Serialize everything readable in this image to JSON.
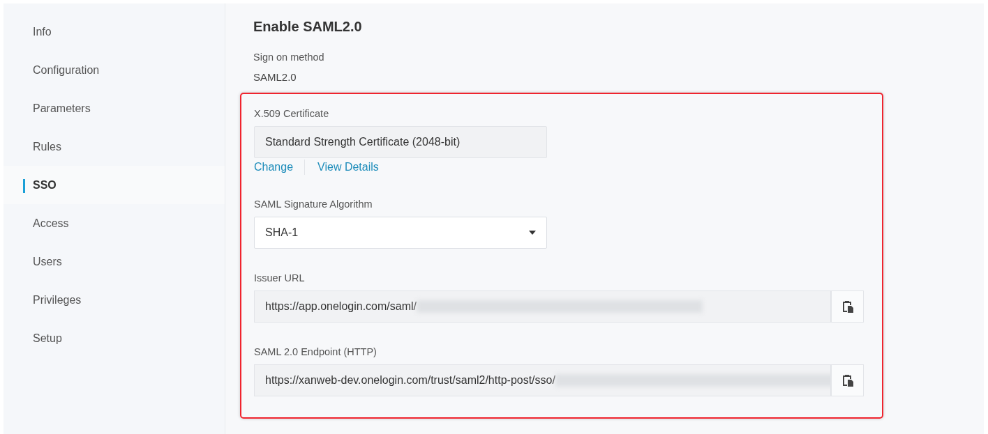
{
  "sidebar": {
    "items": [
      {
        "label": "Info",
        "selected": false
      },
      {
        "label": "Configuration",
        "selected": false
      },
      {
        "label": "Parameters",
        "selected": false
      },
      {
        "label": "Rules",
        "selected": false
      },
      {
        "label": "SSO",
        "selected": true
      },
      {
        "label": "Access",
        "selected": false
      },
      {
        "label": "Users",
        "selected": false
      },
      {
        "label": "Privileges",
        "selected": false
      },
      {
        "label": "Setup",
        "selected": false
      }
    ]
  },
  "main": {
    "title": "Enable SAML2.0",
    "sign_on_method": {
      "label": "Sign on method",
      "value": "SAML2.0"
    },
    "settings": {
      "highlighted": true,
      "certificate": {
        "label": "X.509 Certificate",
        "value": "Standard Strength Certificate (2048-bit)",
        "links": [
          "Change",
          "View Details"
        ]
      },
      "signature_algorithm": {
        "label": "SAML Signature Algorithm",
        "value": "SHA-1"
      },
      "urls": [
        {
          "label": "Issuer URL",
          "value": "https://app.onelogin.com/saml/",
          "redacted": true
        },
        {
          "label": "SAML 2.0 Endpoint (HTTP)",
          "value": "https://xanweb-dev.onelogin.com/trust/saml2/http-post/sso/",
          "redacted": true
        }
      ]
    }
  }
}
